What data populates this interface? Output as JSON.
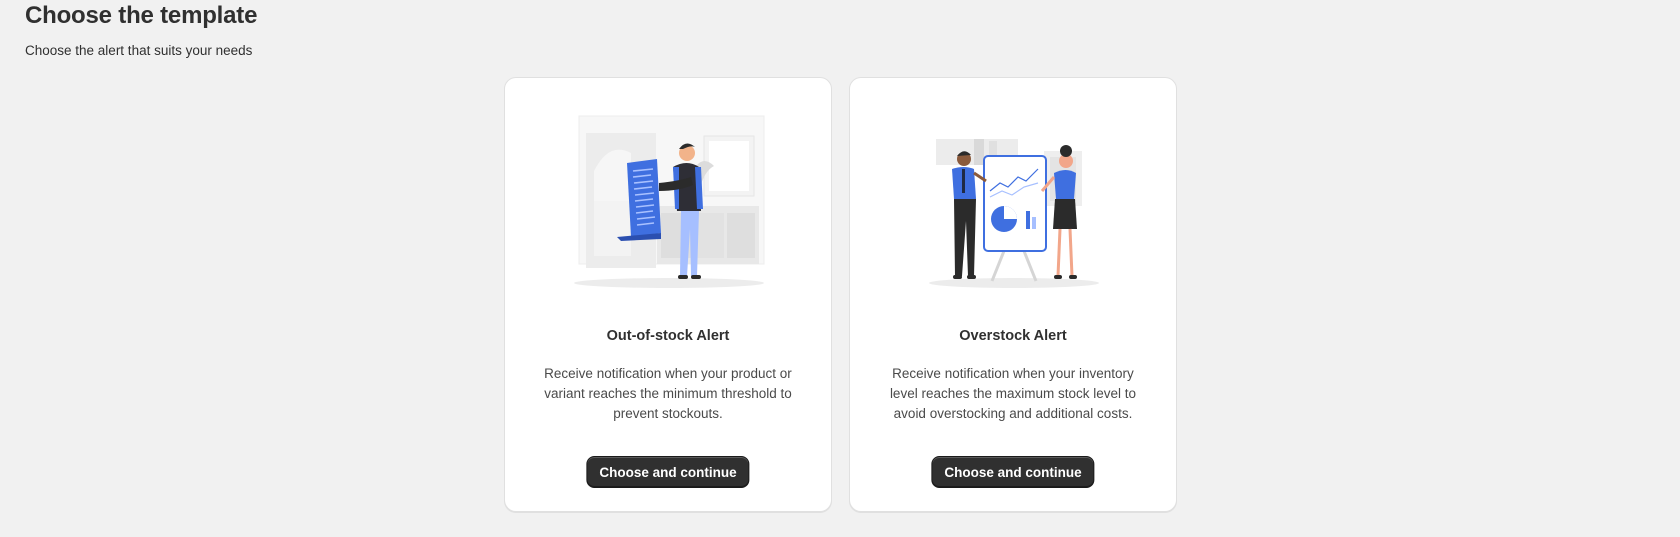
{
  "header": {
    "title": "Choose the template",
    "subtitle": "Choose the alert that suits your needs"
  },
  "templates": [
    {
      "title": "Out-of-stock Alert",
      "description": "Receive notification when your product or variant reaches the minimum threshold to prevent stockouts.",
      "button_label": "Choose and continue",
      "illustration": "person-holding-list-illustration"
    },
    {
      "title": "Overstock Alert",
      "description": "Receive notification when your inventory level reaches the maximum stock level to avoid overstocking and additional costs.",
      "button_label": "Choose and continue",
      "illustration": "two-people-presenting-chart-illustration"
    }
  ],
  "colors": {
    "background": "#f1f1f1",
    "card": "#ffffff",
    "accent_blue": "#3f6fe0",
    "button": "#303030",
    "text": "#303030"
  }
}
